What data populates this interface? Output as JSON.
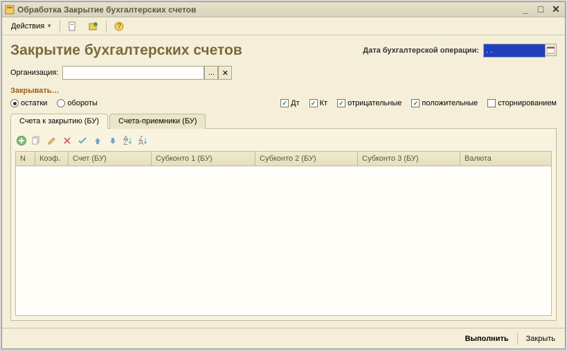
{
  "titlebar": {
    "text": "Обработка  Закрытие бухгалтерских счетов"
  },
  "toolbar": {
    "actions_label": "Действия"
  },
  "header": {
    "title": "Закрытие бухгалтерских счетов",
    "date_label": "Дата бухгалтерской операции:",
    "date_value": ". .",
    "org_label": "Организация:"
  },
  "section": {
    "close_label": "Закрывать…"
  },
  "options": {
    "radio_balances": "остатки",
    "radio_turnover": "обороты",
    "cb_dt": "Дт",
    "cb_kt": "Кт",
    "cb_negative": "отрицательные",
    "cb_positive": "положительные",
    "cb_storno": "сторнированием"
  },
  "tabs": {
    "tab1": "Счета к закрытию (БУ)",
    "tab2": "Счета-приемники (БУ)"
  },
  "grid": {
    "col_n": "N",
    "col_coef": "Коэф.",
    "col_acct": "Счет (БУ)",
    "col_sub1": "Субконто 1 (БУ)",
    "col_sub2": "Субконто 2 (БУ)",
    "col_sub3": "Субконто 3 (БУ)",
    "col_curr": "Валюта"
  },
  "footer": {
    "execute": "Выполнить",
    "close": "Закрыть"
  }
}
